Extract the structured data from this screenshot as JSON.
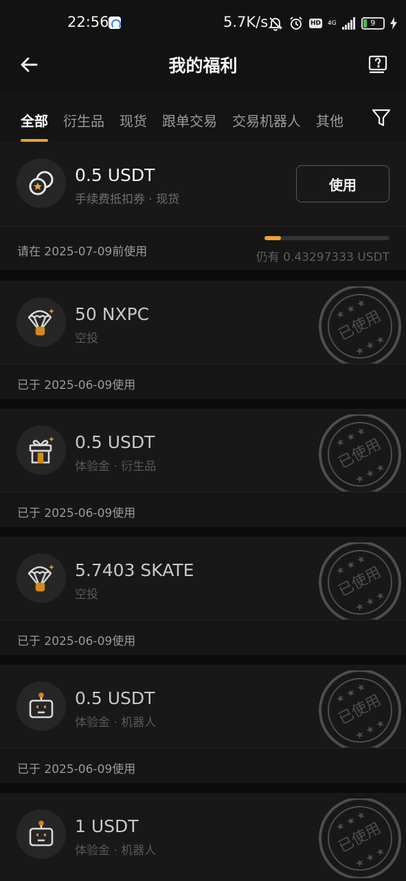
{
  "status_bar": {
    "time": "22:56",
    "net_speed": "5.7K/s",
    "network_type": "4G",
    "hd_label": "HD",
    "battery": "9"
  },
  "header": {
    "title": "我的福利",
    "back_icon": "arrow-left-icon",
    "help_icon": "help-icon"
  },
  "tabs": [
    {
      "label": "全部",
      "active": true
    },
    {
      "label": "衍生品",
      "active": false
    },
    {
      "label": "现货",
      "active": false
    },
    {
      "label": "跟单交易",
      "active": false
    },
    {
      "label": "交易机器人",
      "active": false
    },
    {
      "label": "其他",
      "active": false
    }
  ],
  "filter_icon": "filter-icon",
  "accent_color": "#f0a02c",
  "cards": [
    {
      "amount": "0.5 USDT",
      "subtitle": "手续费抵扣券 · 现货",
      "icon": "coupon-icon",
      "action_label": "使用",
      "expiry": "请在 2025-07-09前使用",
      "remaining": "仍有 0.43297333 USDT",
      "progress": 0.13,
      "status": "active"
    },
    {
      "amount": "50 NXPC",
      "subtitle": "空投",
      "icon": "airdrop-icon",
      "expiry": "已于 2025-06-09使用",
      "stamp": "已使用",
      "status": "used"
    },
    {
      "amount": "0.5 USDT",
      "subtitle": "体验金 · 衍生品",
      "icon": "gift-icon",
      "expiry": "已于 2025-06-09使用",
      "stamp": "已使用",
      "status": "used"
    },
    {
      "amount": "5.7403 SKATE",
      "subtitle": "空投",
      "icon": "airdrop-icon",
      "expiry": "已于 2025-06-09使用",
      "stamp": "已使用",
      "status": "used"
    },
    {
      "amount": "0.5 USDT",
      "subtitle": "体验金 · 机器人",
      "icon": "robot-icon",
      "expiry": "已于 2025-06-09使用",
      "stamp": "已使用",
      "status": "used"
    },
    {
      "amount": "1 USDT",
      "subtitle": "体验金 · 机器人",
      "icon": "robot-icon",
      "stamp": "已使用",
      "status": "used"
    }
  ]
}
